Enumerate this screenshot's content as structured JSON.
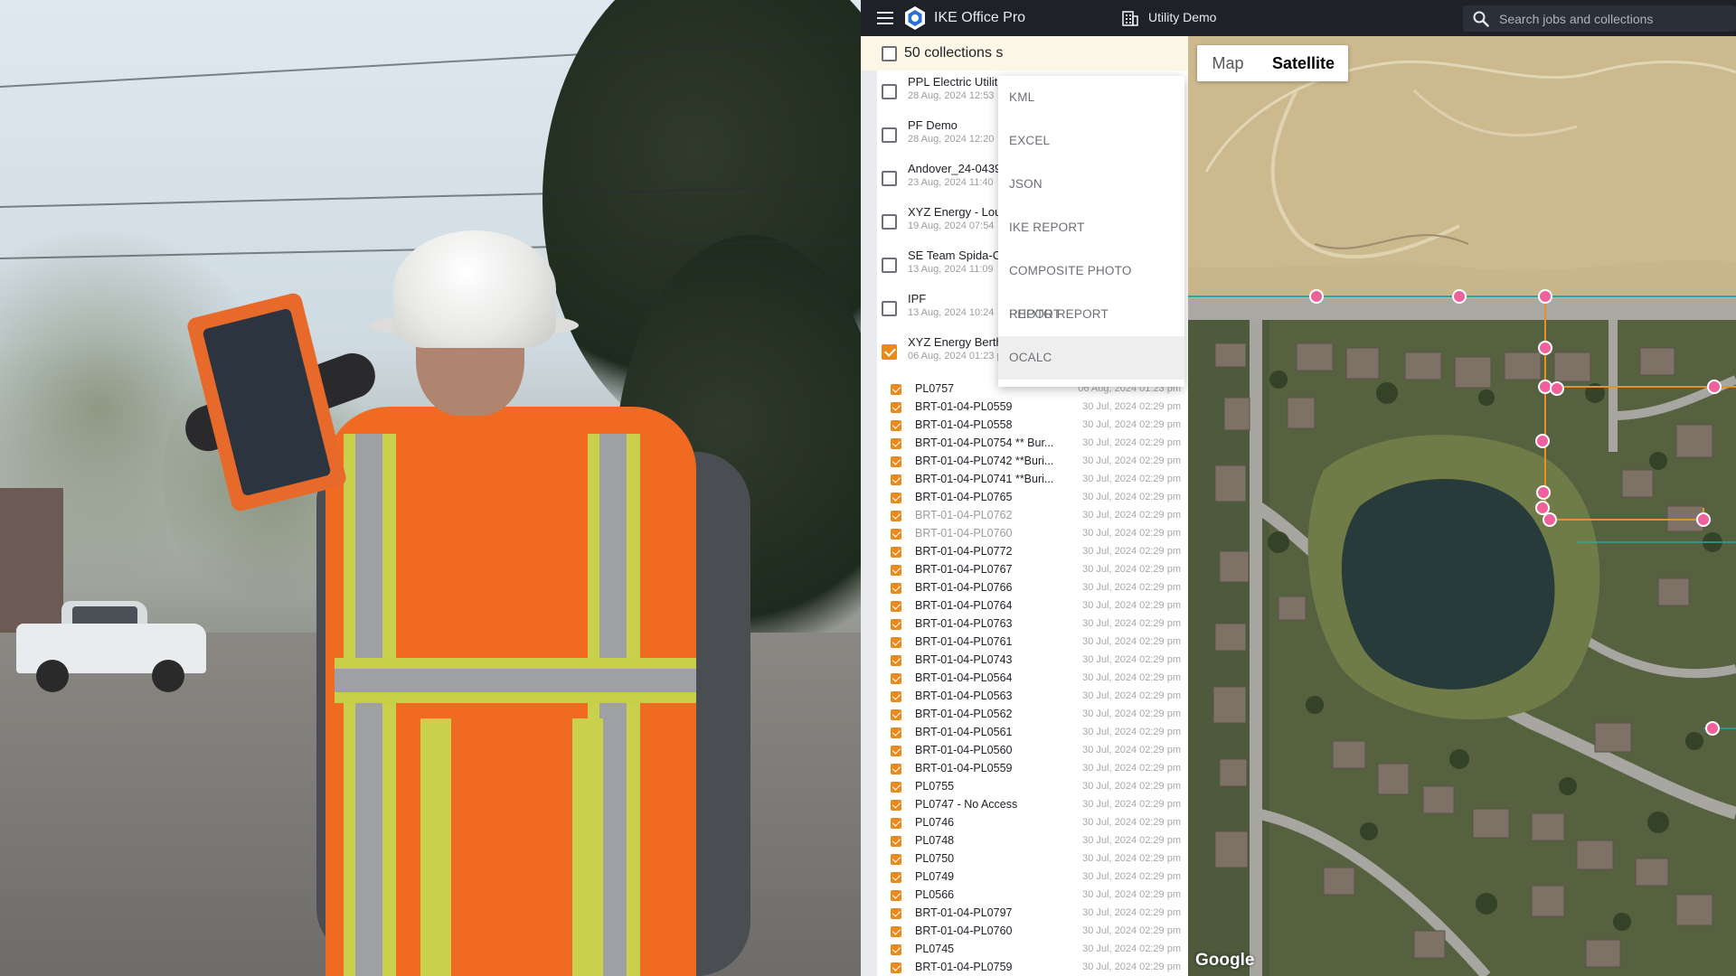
{
  "topbar": {
    "app_title": "IKE Office Pro",
    "org_name": "Utility Demo",
    "search_placeholder": "Search jobs and collections"
  },
  "panel": {
    "selection_label": "50 collections s",
    "collections": [
      {
        "name": "PPL Electric Utiliti",
        "date": "28 Aug, 2024 12:53",
        "checked": false
      },
      {
        "name": "PF Demo",
        "date": "28 Aug, 2024 12:20",
        "checked": false
      },
      {
        "name": "Andover_24-0439",
        "date": "23 Aug, 2024 11:40",
        "checked": false
      },
      {
        "name": "XYZ Energy - Louis",
        "date": "19 Aug, 2024 07:54",
        "checked": false
      },
      {
        "name": "SE Team Spida-Ca",
        "date": "13 Aug, 2024 11:09",
        "checked": false
      },
      {
        "name": "IPF",
        "date": "13 Aug, 2024 10:24",
        "checked": false
      },
      {
        "name": "XYZ Energy Bertho",
        "date": "06 Aug, 2024 01:23 pm",
        "checked": true
      }
    ],
    "items": [
      {
        "name": "PL0757",
        "date": "06 Aug, 2024 01:23 pm",
        "dim": false
      },
      {
        "name": "BRT-01-04-PL0559",
        "date": "30 Jul, 2024 02:29 pm",
        "dim": false
      },
      {
        "name": "BRT-01-04-PL0558",
        "date": "30 Jul, 2024 02:29 pm",
        "dim": false
      },
      {
        "name": "BRT-01-04-PL0754 ** Bur...",
        "date": "30 Jul, 2024 02:29 pm",
        "dim": false
      },
      {
        "name": "BRT-01-04-PL0742 **Buri...",
        "date": "30 Jul, 2024 02:29 pm",
        "dim": false
      },
      {
        "name": "BRT-01-04-PL0741 **Buri...",
        "date": "30 Jul, 2024 02:29 pm",
        "dim": false
      },
      {
        "name": "BRT-01-04-PL0765",
        "date": "30 Jul, 2024 02:29 pm",
        "dim": false
      },
      {
        "name": "BRT-01-04-PL0762",
        "date": "30 Jul, 2024 02:29 pm",
        "dim": true
      },
      {
        "name": "BRT-01-04-PL0760",
        "date": "30 Jul, 2024 02:29 pm",
        "dim": true
      },
      {
        "name": "BRT-01-04-PL0772",
        "date": "30 Jul, 2024 02:29 pm",
        "dim": false
      },
      {
        "name": "BRT-01-04-PL0767",
        "date": "30 Jul, 2024 02:29 pm",
        "dim": false
      },
      {
        "name": "BRT-01-04-PL0766",
        "date": "30 Jul, 2024 02:29 pm",
        "dim": false
      },
      {
        "name": "BRT-01-04-PL0764",
        "date": "30 Jul, 2024 02:29 pm",
        "dim": false
      },
      {
        "name": "BRT-01-04-PL0763",
        "date": "30 Jul, 2024 02:29 pm",
        "dim": false
      },
      {
        "name": "BRT-01-04-PL0761",
        "date": "30 Jul, 2024 02:29 pm",
        "dim": false
      },
      {
        "name": "BRT-01-04-PL0743",
        "date": "30 Jul, 2024 02:29 pm",
        "dim": false
      },
      {
        "name": "BRT-01-04-PL0564",
        "date": "30 Jul, 2024 02:29 pm",
        "dim": false
      },
      {
        "name": "BRT-01-04-PL0563",
        "date": "30 Jul, 2024 02:29 pm",
        "dim": false
      },
      {
        "name": "BRT-01-04-PL0562",
        "date": "30 Jul, 2024 02:29 pm",
        "dim": false
      },
      {
        "name": "BRT-01-04-PL0561",
        "date": "30 Jul, 2024 02:29 pm",
        "dim": false
      },
      {
        "name": "BRT-01-04-PL0560",
        "date": "30 Jul, 2024 02:29 pm",
        "dim": false
      },
      {
        "name": "BRT-01-04-PL0559",
        "date": "30 Jul, 2024 02:29 pm",
        "dim": false
      },
      {
        "name": "PL0755",
        "date": "30 Jul, 2024 02:29 pm",
        "dim": false
      },
      {
        "name": "PL0747 - No Access",
        "date": "30 Jul, 2024 02:29 pm",
        "dim": false
      },
      {
        "name": "PL0746",
        "date": "30 Jul, 2024 02:29 pm",
        "dim": false
      },
      {
        "name": "PL0748",
        "date": "30 Jul, 2024 02:29 pm",
        "dim": false
      },
      {
        "name": "PL0750",
        "date": "30 Jul, 2024 02:29 pm",
        "dim": false
      },
      {
        "name": "PL0749",
        "date": "30 Jul, 2024 02:29 pm",
        "dim": false
      },
      {
        "name": "PL0566",
        "date": "30 Jul, 2024 02:29 pm",
        "dim": false
      },
      {
        "name": "BRT-01-04-PL0797",
        "date": "30 Jul, 2024 02:29 pm",
        "dim": false
      },
      {
        "name": "BRT-01-04-PL0760",
        "date": "30 Jul, 2024 02:29 pm",
        "dim": false
      },
      {
        "name": "PL0745",
        "date": "30 Jul, 2024 02:29 pm",
        "dim": false
      },
      {
        "name": "BRT-01-04-PL0759",
        "date": "30 Jul, 2024 02:29 pm",
        "dim": false
      }
    ]
  },
  "export_menu": {
    "items": [
      "KML",
      "EXCEL",
      "JSON",
      "IKE REPORT",
      "COMPOSITE PHOTO REPORT",
      "PHOTO REPORT",
      "OCALC"
    ],
    "active": "OCALC"
  },
  "map": {
    "types": [
      "Map",
      "Satellite"
    ],
    "selected_type": "Satellite",
    "attribution": "Google",
    "marker_color": "#f0609a",
    "line_color": "#e8912a"
  },
  "colors": {
    "accent": "#e88a1c",
    "topbar_bg": "#1e2128"
  }
}
